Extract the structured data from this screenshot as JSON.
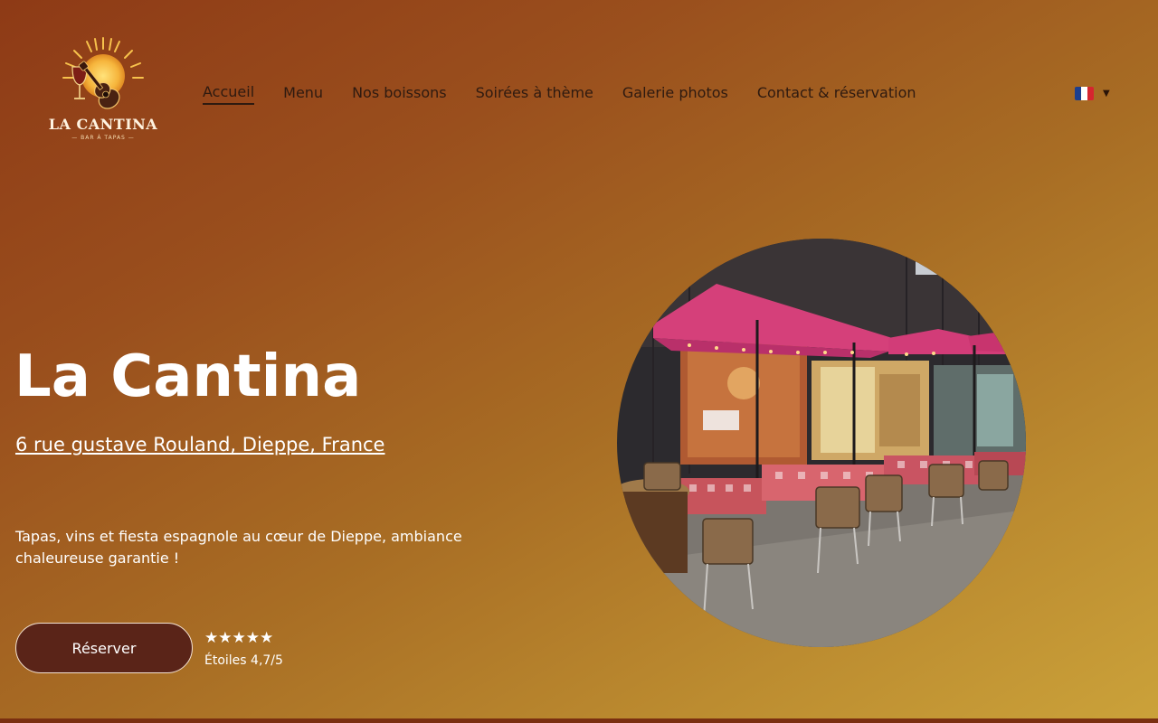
{
  "logo": {
    "name": "LA CANTINA",
    "tagline": "BAR À TAPAS"
  },
  "nav": {
    "items": [
      {
        "label": "Accueil",
        "active": true
      },
      {
        "label": "Menu",
        "active": false
      },
      {
        "label": "Nos boissons",
        "active": false
      },
      {
        "label": "Soirées à thème",
        "active": false
      },
      {
        "label": "Galerie photos",
        "active": false
      },
      {
        "label": "Contact & réservation",
        "active": false
      }
    ]
  },
  "language": {
    "flag_icon": "france-flag-icon",
    "flag_colors": [
      "#1d3f8f",
      "#ffffff",
      "#d6252f"
    ]
  },
  "hero": {
    "title": "La Cantina",
    "address": "6 rue gustave Rouland, Dieppe, France",
    "description": "Tapas, vins et fiesta espagnole au cœur de Dieppe, ambiance chaleureuse garantie !",
    "reserve_label": "Réserver",
    "stars": "★★★★★",
    "rating_text": "Étoiles 4,7/5",
    "rating_value": 4.7
  },
  "colors": {
    "gradient_start": "#8e3a16",
    "gradient_end": "#cba23a",
    "button_bg": "#5a2418",
    "nav_text": "#2e1a10"
  }
}
